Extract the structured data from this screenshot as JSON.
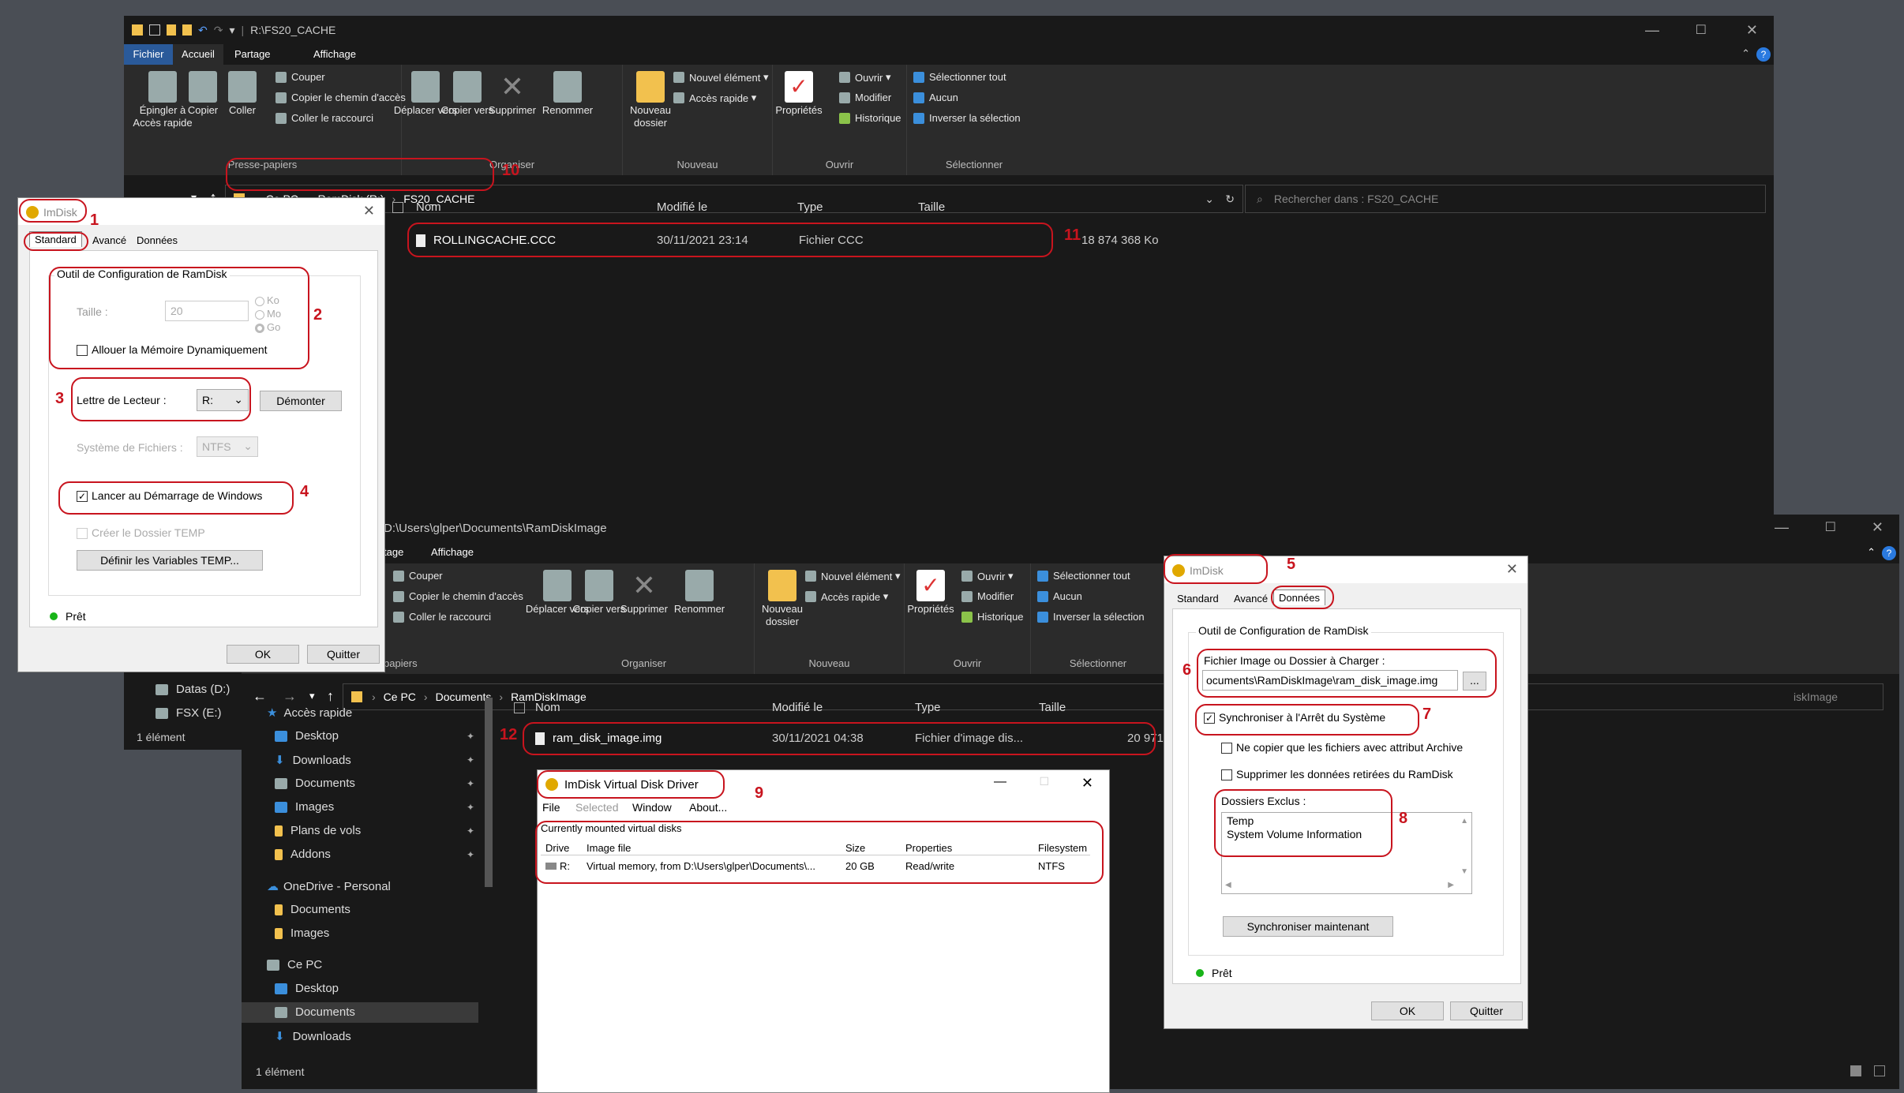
{
  "explorer1": {
    "title": "R:\\FS20_CACHE",
    "tabs": [
      "Fichier",
      "Accueil",
      "Partage",
      "Affichage"
    ],
    "ribbon": {
      "presse_papiers": {
        "pin": "Épingler à Accès rapide",
        "copy": "Copier",
        "paste": "Coller",
        "cut": "Couper",
        "copy_path": "Copier le chemin d'accès",
        "paste_shortcut": "Coller le raccourci",
        "label": "Presse-papiers"
      },
      "organiser": {
        "move": "Déplacer vers",
        "copy_to": "Copier vers",
        "delete": "Supprimer",
        "rename": "Renommer",
        "label": "Organiser"
      },
      "nouveau": {
        "new_folder": "Nouveau dossier",
        "new_item": "Nouvel élément",
        "quick_access": "Accès rapide",
        "label": "Nouveau"
      },
      "ouvrir": {
        "properties": "Propriétés",
        "open": "Ouvrir",
        "edit": "Modifier",
        "history": "Historique",
        "label": "Ouvrir"
      },
      "selectionner": {
        "select_all": "Sélectionner tout",
        "none": "Aucun",
        "invert": "Inverser la sélection",
        "label": "Sélectionner"
      }
    },
    "breadcrumb": [
      "Ce PC",
      "RamDisk (R:)",
      "FS20_CACHE"
    ],
    "search_placeholder": "Rechercher dans : FS20_CACHE",
    "columns": [
      "Nom",
      "Modifié le",
      "Type",
      "Taille"
    ],
    "file": {
      "name": "ROLLINGCACHE.CCC",
      "modified": "30/11/2021 23:14",
      "type": "Fichier CCC",
      "size": "18 874 368 Ko"
    },
    "nav_items": [
      "Datas (D:)",
      "FSX (E:)"
    ],
    "status": "1 élément"
  },
  "explorer2": {
    "title": "D:\\Users\\glper\\Documents\\RamDiskImage",
    "tabs": [
      "tage",
      "Affichage"
    ],
    "breadcrumb": [
      "Ce PC",
      "Documents",
      "RamDiskImage"
    ],
    "search_fragment": "iskImage",
    "columns": [
      "Nom",
      "Modifié le",
      "Type",
      "Taille"
    ],
    "file": {
      "name": "ram_disk_image.img",
      "modified": "30/11/2021 04:38",
      "type": "Fichier d'image dis...",
      "size": "20 971 520 Ko"
    },
    "nav": {
      "quick_access": "Accès rapide",
      "quick_items": [
        "Desktop",
        "Downloads",
        "Documents",
        "Images",
        "Plans de vols",
        "Addons"
      ],
      "onedrive": "OneDrive - Personal",
      "onedrive_items": [
        "Documents",
        "Images"
      ],
      "this_pc": "Ce PC",
      "pc_items": [
        "Desktop",
        "Documents",
        "Downloads"
      ]
    },
    "ribbon_clip": {
      "cut": "Couper",
      "copy_path": "Copier le chemin d'accès",
      "paste_shortcut": "Coller le raccourci",
      "label": "papiers"
    },
    "status": "1 élément"
  },
  "imdisk1": {
    "title": "ImDisk",
    "tabs": [
      "Standard",
      "Avancé",
      "Données"
    ],
    "group": "Outil de Configuration de RamDisk",
    "size_label": "Taille :",
    "size_value": "20",
    "units": [
      "Ko",
      "Mo",
      "Go"
    ],
    "dynamic": "Allouer la Mémoire Dynamiquement",
    "drive_label": "Lettre de Lecteur :",
    "drive_value": "R:",
    "unmount": "Démonter",
    "fs_label": "Système de Fichiers :",
    "fs_value": "NTFS",
    "startup": "Lancer au Démarrage de Windows",
    "temp": "Créer le Dossier TEMP",
    "temp_vars": "Définir les Variables TEMP...",
    "status": "Prêt",
    "ok": "OK",
    "quit": "Quitter"
  },
  "imdisk2": {
    "title": "ImDisk",
    "tabs": [
      "Standard",
      "Avancé",
      "Données"
    ],
    "group": "Outil de Configuration de RamDisk",
    "image_label": "Fichier Image ou Dossier à Charger :",
    "image_value": "ocuments\\RamDiskImage\\ram_disk_image.img",
    "browse": "...",
    "sync": "Synchroniser à l'Arrêt du Système",
    "archive": "Ne copier que les fichiers avec attribut Archive",
    "delete": "Supprimer les données retirées du RamDisk",
    "excluded_label": "Dossiers Exclus :",
    "excluded": [
      "Temp",
      "System Volume Information"
    ],
    "sync_now": "Synchroniser maintenant",
    "status": "Prêt",
    "ok": "OK",
    "quit": "Quitter"
  },
  "vdd": {
    "title": "ImDisk Virtual Disk Driver",
    "menu": [
      "File",
      "Selected",
      "Window",
      "About..."
    ],
    "caption": "Currently mounted virtual disks",
    "columns": [
      "Drive",
      "Image file",
      "Size",
      "Properties",
      "Filesystem"
    ],
    "row": {
      "drive": "R:",
      "image": "Virtual memory, from D:\\Users\\glper\\Documents\\...",
      "size": "20 GB",
      "props": "Read/write",
      "fs": "NTFS"
    }
  },
  "annotations": [
    "1",
    "2",
    "3",
    "4",
    "5",
    "6",
    "7",
    "8",
    "9",
    "10",
    "11",
    "12"
  ]
}
